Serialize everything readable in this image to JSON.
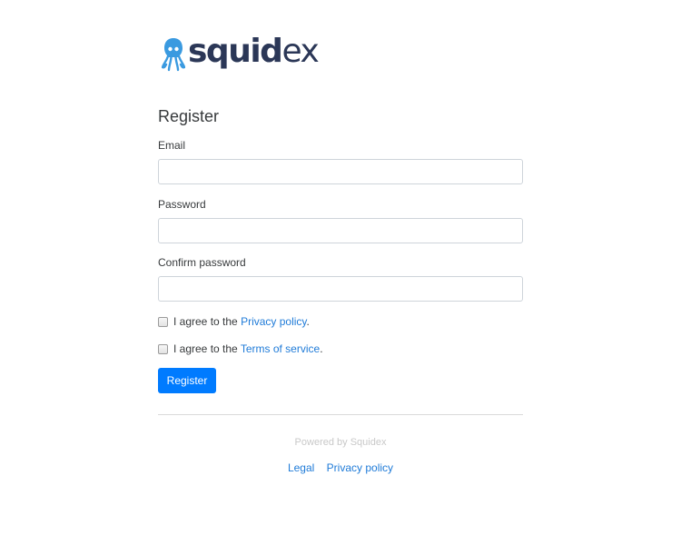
{
  "brand": {
    "logo_main": "squid",
    "logo_suffix": "ex",
    "logo_color": "#2b3757",
    "mark_color": "#3a9ae0"
  },
  "form": {
    "title": "Register",
    "email_label": "Email",
    "email_value": "",
    "password_label": "Password",
    "password_value": "",
    "confirm_label": "Confirm password",
    "confirm_value": "",
    "privacy_prefix": "I agree to the ",
    "privacy_link": "Privacy policy",
    "privacy_suffix": ".",
    "privacy_checked": false,
    "terms_prefix": "I agree to the ",
    "terms_link": "Terms of service",
    "terms_suffix": ".",
    "terms_checked": false,
    "submit_label": "Register",
    "submit_color": "#007bff"
  },
  "footer": {
    "powered_by": "Powered by Squidex",
    "links": [
      "Legal",
      "Privacy policy"
    ],
    "link_color": "#1f7bd8"
  }
}
